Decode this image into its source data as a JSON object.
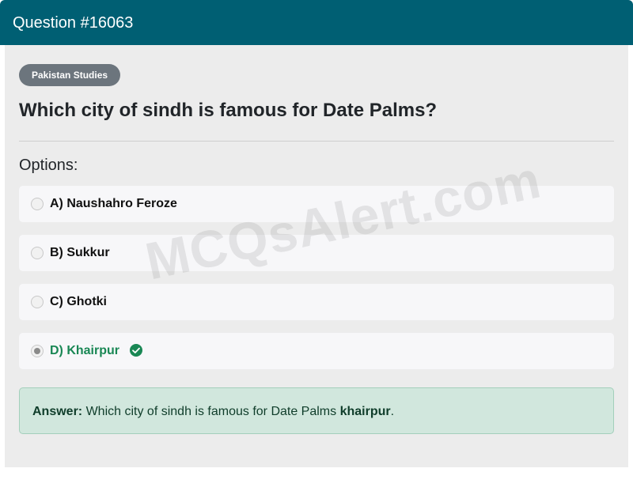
{
  "header": {
    "title": "Question #16063"
  },
  "category": "Pakistan Studies",
  "question": "Which city of sindh is famous for Date Palms?",
  "options_heading": "Options:",
  "options": [
    {
      "label": "A) Naushahro Feroze",
      "selected": false,
      "correct": false
    },
    {
      "label": "B) Sukkur",
      "selected": false,
      "correct": false
    },
    {
      "label": "C) Ghotki",
      "selected": false,
      "correct": false
    },
    {
      "label": "D) Khairpur",
      "selected": true,
      "correct": true,
      "icon": "check-circle-icon"
    }
  ],
  "answer": {
    "prefix": "Answer:",
    "text": "Which city of sindh is famous for Date Palms",
    "highlight": "khairpur",
    "suffix": "."
  },
  "watermark": "MCQsAlert.com",
  "colors": {
    "header": "#005f73",
    "badge": "#6c757d",
    "correct": "#198754",
    "answer_bg": "#d1e7dd"
  }
}
